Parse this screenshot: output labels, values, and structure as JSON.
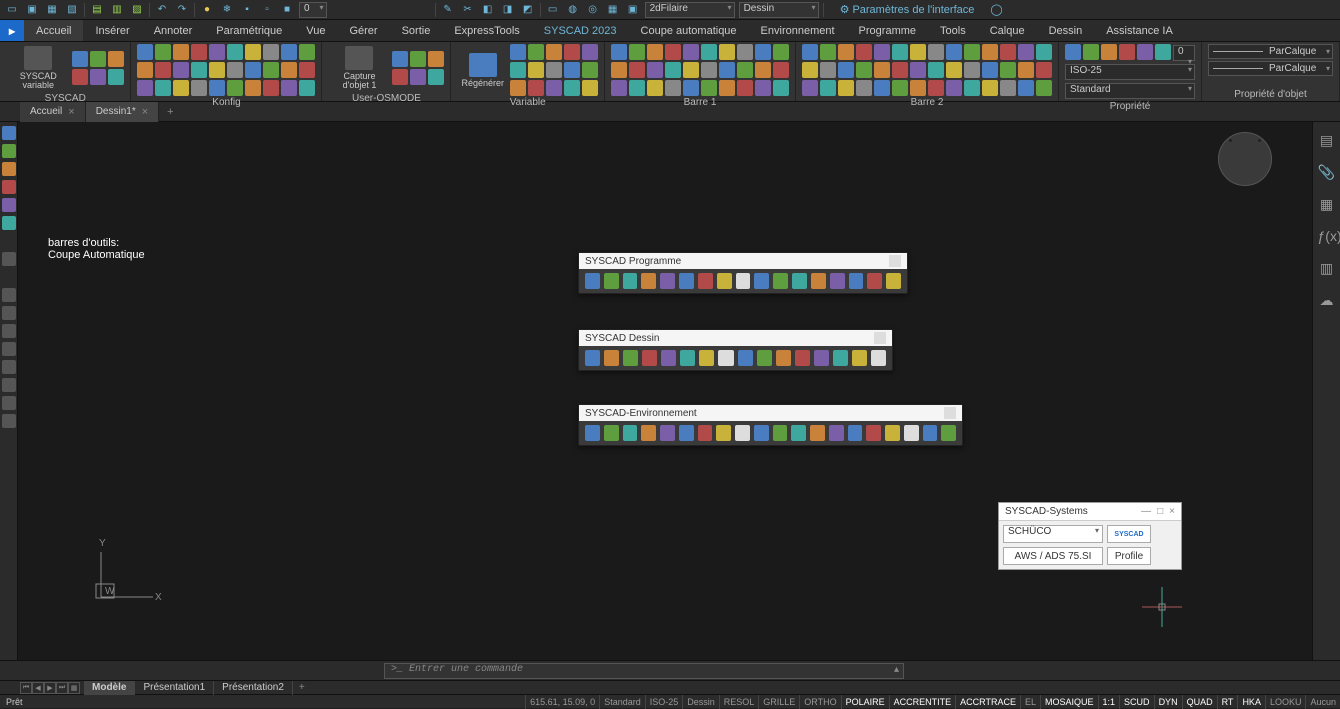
{
  "qat": {
    "layer_zero": "0",
    "style_combo": "2dFilaire",
    "workspace_combo": "Dessin",
    "interface_label": "Paramètres de l'interface"
  },
  "ribbon_tabs": [
    "Accueil",
    "Insérer",
    "Annoter",
    "Paramétrique",
    "Vue",
    "Gérer",
    "Sortie",
    "ExpressTools",
    "SYSCAD 2023",
    "Coupe automatique",
    "Environnement",
    "Programme",
    "Tools",
    "Calque",
    "Dessin",
    "Assistance IA"
  ],
  "ribbon": {
    "syscad_btn": "SYSCAD variable",
    "panels": [
      "SYSCAD",
      "Konfig",
      "User-OSMODE",
      "Variable",
      "Barre 1",
      "Barre 2",
      "Propriété",
      "Propriété d'objet"
    ],
    "capture_btn": "Capture d'objet 1",
    "regen_btn": "Régénérer",
    "dimstyle": "ISO-25",
    "textstyle": "Standard",
    "bylayer": "ParCalque"
  },
  "filetabs": {
    "tabs": [
      "Accueil",
      "Dessin1*"
    ]
  },
  "annotation": {
    "line1": "barres d'outils:",
    "line2": "Coupe Automatique"
  },
  "float1": {
    "title": "SYSCAD Programme"
  },
  "float2": {
    "title": "SYSCAD Dessin"
  },
  "float3": {
    "title": "SYSCAD-Environnement"
  },
  "systems": {
    "title": "SYSCAD-Systems",
    "brand": "SCHÜCO",
    "product": "AWS / ADS 75.SI",
    "profile_btn": "Profile",
    "logo": "SYSCAD"
  },
  "wcs": {
    "y": "Y",
    "x": "X",
    "w": "W"
  },
  "cmd": {
    "prompt": ">_ Entrer une commande"
  },
  "modeltabs": {
    "model": "Modèle",
    "p1": "Présentation1",
    "p2": "Présentation2"
  },
  "status": {
    "ready": "Prêt",
    "coords": "615.61, 15.09, 0",
    "dimstyle": "Standard",
    "iso": "ISO-25",
    "space": "Dessin",
    "cells": [
      "RESOL",
      "GRILLE",
      "ORTHO",
      "POLAIRE",
      "ACCRENTITE",
      "ACCRTRACE",
      "EL",
      "MOSAIQUE",
      "1:1",
      "SCUD",
      "DYN",
      "QUAD",
      "RT",
      "HKA",
      "LOOKU",
      "Aucun"
    ]
  }
}
